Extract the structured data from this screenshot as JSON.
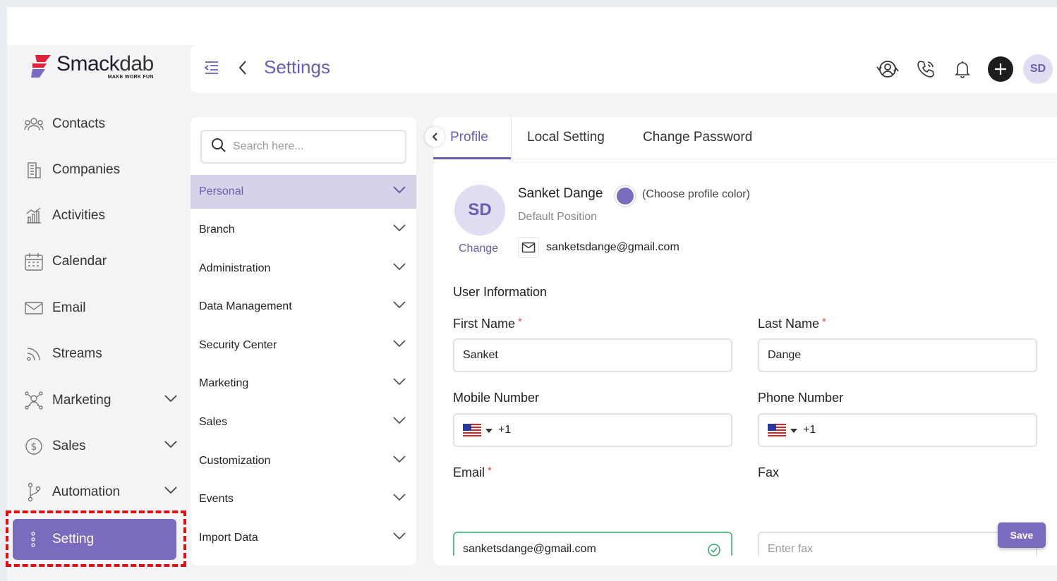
{
  "brand": {
    "name_main": "Smack",
    "name_rest": "dab",
    "tagline": "MAKE WORK FUN",
    "accent": "#7b6bbf",
    "logo_red": "#e0223a"
  },
  "header": {
    "title": "Settings"
  },
  "nav": {
    "items": [
      {
        "label": "Contacts",
        "icon": "contacts-icon"
      },
      {
        "label": "Companies",
        "icon": "companies-icon"
      },
      {
        "label": "Activities",
        "icon": "activities-icon"
      },
      {
        "label": "Calendar",
        "icon": "calendar-icon"
      },
      {
        "label": "Email",
        "icon": "email-icon"
      },
      {
        "label": "Streams",
        "icon": "streams-icon"
      },
      {
        "label": "Marketing",
        "icon": "marketing-icon",
        "expandable": true
      },
      {
        "label": "Sales",
        "icon": "sales-icon",
        "expandable": true
      },
      {
        "label": "Automation",
        "icon": "automation-icon",
        "expandable": true
      }
    ],
    "active": {
      "label": "Setting",
      "icon": "dots-vertical-icon"
    }
  },
  "topbar": {
    "avatar_initials": "SD"
  },
  "settings_menu": {
    "search_placeholder": "Search here...",
    "items": [
      {
        "label": "Personal",
        "active": true
      },
      {
        "label": "Branch"
      },
      {
        "label": "Administration"
      },
      {
        "label": "Data Management"
      },
      {
        "label": "Security Center"
      },
      {
        "label": "Marketing"
      },
      {
        "label": "Sales"
      },
      {
        "label": "Customization"
      },
      {
        "label": "Events"
      },
      {
        "label": "Import Data"
      }
    ]
  },
  "tabs": [
    {
      "label": "Profile",
      "active": true
    },
    {
      "label": "Local Setting"
    },
    {
      "label": "Change Password"
    }
  ],
  "profile": {
    "initials": "SD",
    "change_label": "Change",
    "name": "Sanket Dange",
    "choose_color_label": "(Choose profile color)",
    "profile_color": "#7b6bbf",
    "position": "Default Position",
    "email": "sanketsdange@gmail.com"
  },
  "form": {
    "section_title": "User Information",
    "first_name": {
      "label": "First Name",
      "value": "Sanket",
      "required": "*"
    },
    "last_name": {
      "label": "Last Name",
      "value": "Dange",
      "required": "*"
    },
    "mobile": {
      "label": "Mobile Number",
      "dial_code": "+1"
    },
    "phone": {
      "label": "Phone Number",
      "dial_code": "+1"
    },
    "email": {
      "label": "Email",
      "value": "sanketsdange@gmail.com",
      "required": "*"
    },
    "fax": {
      "label": "Fax",
      "placeholder": "Enter fax"
    }
  },
  "actions": {
    "save_label": "Save"
  }
}
